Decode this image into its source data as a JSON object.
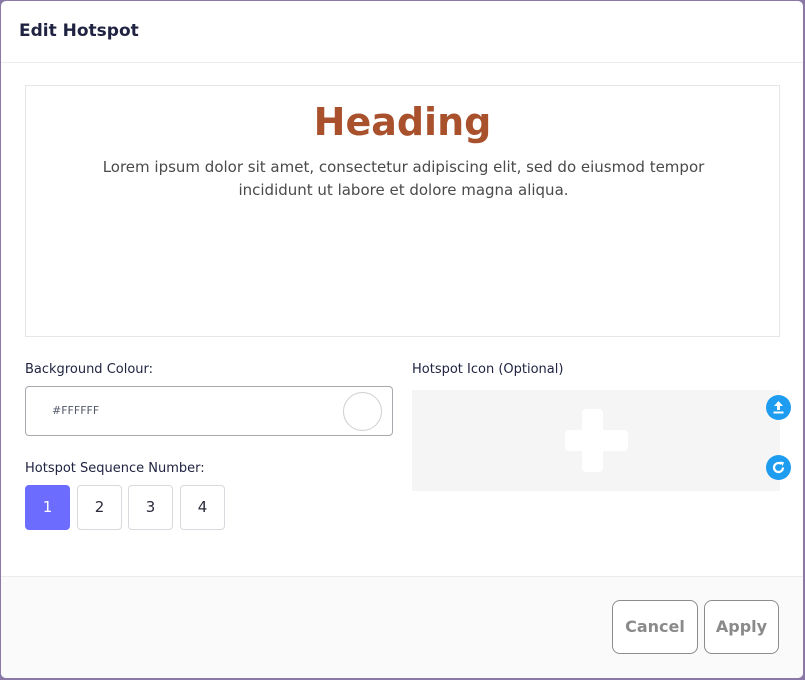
{
  "modal": {
    "title": "Edit Hotspot"
  },
  "preview": {
    "heading": "Heading",
    "body": "Lorem ipsum dolor sit amet, consectetur adipiscing elit, sed do eiusmod tempor incididunt ut labore et dolore magna aliqua.",
    "heading_color": "#a8512c"
  },
  "background": {
    "label": "Background Colour:",
    "value": "#FFFFFF"
  },
  "sequence": {
    "label": "Hotspot Sequence Number:",
    "options": [
      "1",
      "2",
      "3",
      "4"
    ],
    "selected": "1",
    "accent": "#6c6cff"
  },
  "hotspot_icon": {
    "label": "Hotspot Icon (Optional)",
    "placeholder_icon": "plus-icon",
    "upload_icon": "upload-icon",
    "reset_icon": "refresh-icon",
    "button_color": "#1e9cf0"
  },
  "footer": {
    "cancel_label": "Cancel",
    "apply_label": "Apply"
  }
}
